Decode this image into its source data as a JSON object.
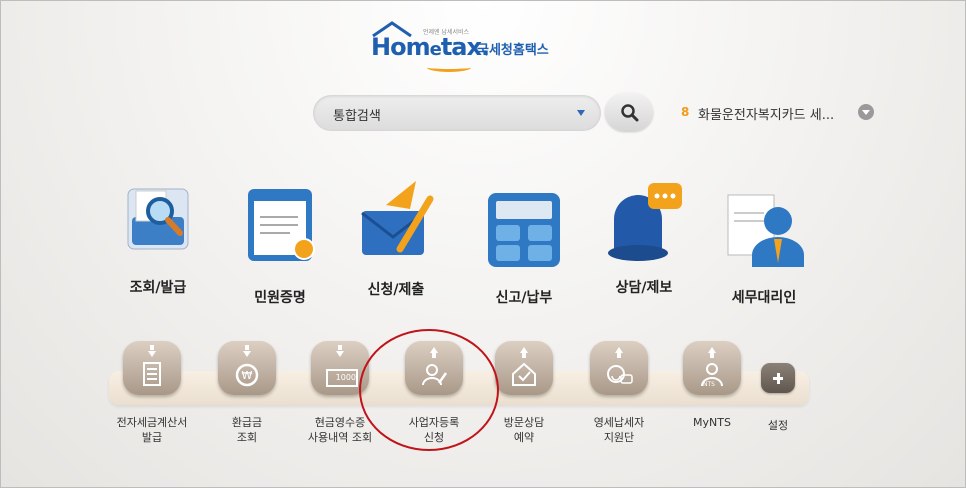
{
  "logo": {
    "word_pre": "Hom",
    "word_e": "e",
    "word_post": "tax.",
    "sub": "언제엔 납세서비스",
    "kr": "국세청홈택스"
  },
  "search": {
    "placeholder_label": "통합검색"
  },
  "ranking": {
    "number": "8",
    "text": "화물운전자복지카드 세..."
  },
  "main_menu": [
    {
      "label": "조회/발급"
    },
    {
      "label": "민원증명"
    },
    {
      "label": "신청/제출"
    },
    {
      "label": "신고/납부"
    },
    {
      "label": "상담/제보"
    },
    {
      "label": "세무대리인"
    }
  ],
  "quick_menu": [
    {
      "line1": "전자세금계산서",
      "line2": "발급"
    },
    {
      "line1": "환급금",
      "line2": "조회"
    },
    {
      "line1": "현금영수증",
      "line2": "사용내역 조회",
      "badge": "1000"
    },
    {
      "line1": "사업자등록",
      "line2": "신청"
    },
    {
      "line1": "방문상담",
      "line2": "예약"
    },
    {
      "line1": "영세납세자",
      "line2": "지원단"
    },
    {
      "line1": "MyNTS",
      "line2": "",
      "badge": "NTS"
    }
  ],
  "settings_label": "설정",
  "colors": {
    "brand_blue": "#1f5fb0",
    "brand_orange": "#f3a21b",
    "highlight_red": "#c0141b"
  }
}
